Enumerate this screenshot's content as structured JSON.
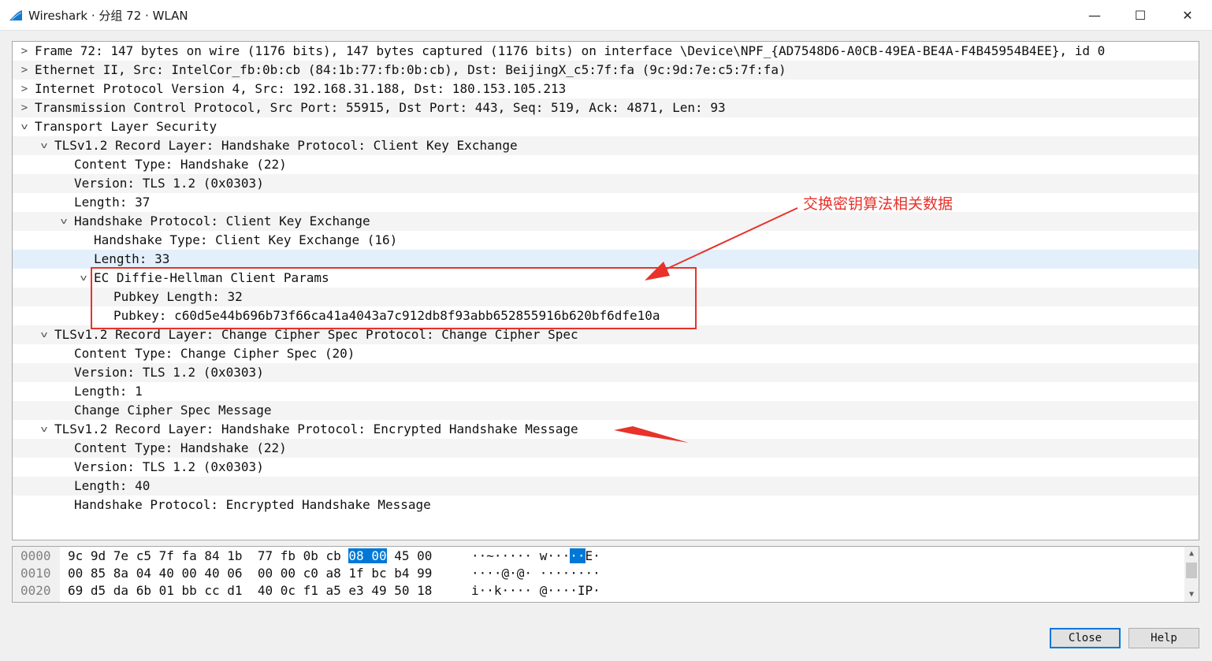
{
  "window": {
    "title": "Wireshark · 分组 72 · WLAN",
    "minimize_glyph": "—",
    "maximize_glyph": "☐",
    "close_glyph": "✕"
  },
  "tree": [
    {
      "indent": 0,
      "arrow": ">",
      "text": "Frame 72: 147 bytes on wire (1176 bits), 147 bytes captured (1176 bits) on interface \\Device\\NPF_{AD7548D6-A0CB-49EA-BE4A-F4B45954B4EE}, id 0"
    },
    {
      "indent": 0,
      "arrow": ">",
      "text": "Ethernet II, Src: IntelCor_fb:0b:cb (84:1b:77:fb:0b:cb), Dst: BeijingX_c5:7f:fa (9c:9d:7e:c5:7f:fa)"
    },
    {
      "indent": 0,
      "arrow": ">",
      "text": "Internet Protocol Version 4, Src: 192.168.31.188, Dst: 180.153.105.213"
    },
    {
      "indent": 0,
      "arrow": ">",
      "text": "Transmission Control Protocol, Src Port: 55915, Dst Port: 443, Seq: 519, Ack: 4871, Len: 93"
    },
    {
      "indent": 0,
      "arrow": "v",
      "text": "Transport Layer Security"
    },
    {
      "indent": 1,
      "arrow": "v",
      "text": "TLSv1.2 Record Layer: Handshake Protocol: Client Key Exchange"
    },
    {
      "indent": 2,
      "arrow": "",
      "text": "Content Type: Handshake (22)"
    },
    {
      "indent": 2,
      "arrow": "",
      "text": "Version: TLS 1.2 (0x0303)"
    },
    {
      "indent": 2,
      "arrow": "",
      "text": "Length: 37"
    },
    {
      "indent": 2,
      "arrow": "v",
      "text": "Handshake Protocol: Client Key Exchange"
    },
    {
      "indent": 3,
      "arrow": "",
      "text": "Handshake Type: Client Key Exchange (16)"
    },
    {
      "indent": 3,
      "arrow": "",
      "text": "Length: 33",
      "highlight": true
    },
    {
      "indent": 3,
      "arrow": "v",
      "text": "EC Diffie-Hellman Client Params"
    },
    {
      "indent": 4,
      "arrow": "",
      "text": "Pubkey Length: 32"
    },
    {
      "indent": 4,
      "arrow": "",
      "text": "Pubkey: c60d5e44b696b73f66ca41a4043a7c912db8f93abb652855916b620bf6dfe10a"
    },
    {
      "indent": 1,
      "arrow": "v",
      "text": "TLSv1.2 Record Layer: Change Cipher Spec Protocol: Change Cipher Spec"
    },
    {
      "indent": 2,
      "arrow": "",
      "text": "Content Type: Change Cipher Spec (20)"
    },
    {
      "indent": 2,
      "arrow": "",
      "text": "Version: TLS 1.2 (0x0303)"
    },
    {
      "indent": 2,
      "arrow": "",
      "text": "Length: 1"
    },
    {
      "indent": 2,
      "arrow": "",
      "text": "Change Cipher Spec Message"
    },
    {
      "indent": 1,
      "arrow": "v",
      "text": "TLSv1.2 Record Layer: Handshake Protocol: Encrypted Handshake Message"
    },
    {
      "indent": 2,
      "arrow": "",
      "text": "Content Type: Handshake (22)"
    },
    {
      "indent": 2,
      "arrow": "",
      "text": "Version: TLS 1.2 (0x0303)"
    },
    {
      "indent": 2,
      "arrow": "",
      "text": "Length: 40"
    },
    {
      "indent": 2,
      "arrow": "",
      "text": "Handshake Protocol: Encrypted Handshake Message"
    }
  ],
  "hex": [
    {
      "offset": "0000",
      "bytes_pre": "9c 9d 7e c5 7f fa 84 1b  77 fb 0b cb ",
      "bytes_sel": "08 00",
      "bytes_post": " 45 00",
      "ascii_pre": "··~····· w···",
      "ascii_sel": "··",
      "ascii_post": "E·"
    },
    {
      "offset": "0010",
      "bytes_pre": "00 85 8a 04 40 00 40 06  00 00 c0 a8 1f bc b4 99",
      "bytes_sel": "",
      "bytes_post": "",
      "ascii_pre": "····@·@· ········",
      "ascii_sel": "",
      "ascii_post": ""
    },
    {
      "offset": "0020",
      "bytes_pre": "69 d5 da 6b 01 bb cc d1  40 0c f1 a5 e3 49 50 18",
      "bytes_sel": "",
      "bytes_post": "",
      "ascii_pre": "i··k···· @····IP·",
      "ascii_sel": "",
      "ascii_post": ""
    }
  ],
  "buttons": {
    "close": "Close",
    "help": "Help"
  },
  "annotation": {
    "label": "交换密钥算法相关数据"
  },
  "colors": {
    "accent": "#0078d7",
    "annotation": "#e8322a",
    "row_highlight": "#e3f0fb"
  },
  "icons": {
    "app": "wireshark-fin-icon",
    "collapsed": "chevron-right-icon",
    "expanded": "chevron-down-icon"
  }
}
